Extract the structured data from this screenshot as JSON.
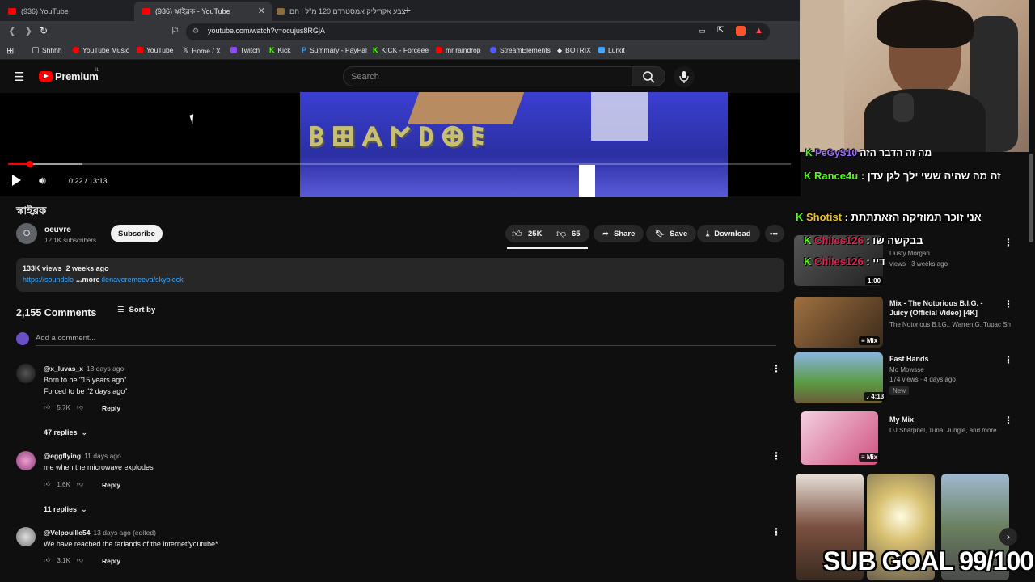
{
  "browser": {
    "tabs": [
      {
        "label": "(936) YouTube"
      },
      {
        "label": "(936) স্কাইব্লক - YouTube"
      },
      {
        "label": "צבע אקריליק אמסטרדם 120 מ\"ל | חם"
      }
    ],
    "new_tab": "+",
    "url": "youtube.com/watch?v=ocujus8RGjA",
    "bookmarks": [
      {
        "label": "Shhhh",
        "color": "#9aa0a6"
      },
      {
        "label": "YouTube Music",
        "color": "#ff0000"
      },
      {
        "label": "YouTube",
        "color": "#ff0000"
      },
      {
        "label": "Home / X",
        "color": "#ffffff"
      },
      {
        "label": "Twitch",
        "color": "#9146ff"
      },
      {
        "label": "Kick",
        "color": "#53fc18"
      },
      {
        "label": "Summary - PayPal",
        "color": "#0070e0"
      },
      {
        "label": "KICK - Forceee",
        "color": "#53fc18"
      },
      {
        "label": "mr raindrop",
        "color": "#ff0000"
      },
      {
        "label": "StreamElements",
        "color": "#4e5bff"
      },
      {
        "label": "BOTRIX",
        "color": "#ffffff"
      },
      {
        "label": "Lurkit",
        "color": "#3ea6ff"
      }
    ]
  },
  "header": {
    "logo_text": "Premium",
    "logo_sup": "IL",
    "search_placeholder": "Search"
  },
  "player": {
    "time": "0:22 / 13:13",
    "progress_fraction": 0.028,
    "buffered_fraction": 0.095
  },
  "video": {
    "title": "স্কাইব্লক",
    "channel_initial": "O",
    "channel_name": "oeuvre",
    "subscribers": "12.1K subscribers",
    "subscribe_label": "Subscribe",
    "likes": "25K",
    "dislikes": "65",
    "share_label": "Share",
    "save_label": "Save",
    "download_label": "Download",
    "views": "133K views",
    "age": "2 weeks ago",
    "desc_link": "https://soundcloud.com/alenaveremeeva/skyblock",
    "more_label": "...more"
  },
  "comments": {
    "count": "2,155 Comments",
    "sort_label": "Sort by",
    "add_placeholder": "Add a comment...",
    "items": [
      {
        "user": "@x_luvas_x",
        "time": "13 days ago",
        "lines": [
          "Born to be \"15 years ago\"",
          "Forced to be \"2 days ago\""
        ],
        "likes": "5.7K",
        "reply_label": "Reply",
        "replies": "47 replies"
      },
      {
        "user": "@eggflying",
        "time": "11 days ago",
        "lines": [
          "me when the microwave explodes"
        ],
        "likes": "1.6K",
        "reply_label": "Reply",
        "replies": "11 replies"
      },
      {
        "user": "@Velpouille54",
        "time": "13 days ago (edited)",
        "lines": [
          "We have reached the farlands of the internet/youtube*"
        ],
        "likes": "3.1K",
        "reply_label": "Reply"
      }
    ]
  },
  "stream_overlay": {
    "chat": [
      {
        "user": "PeGyS10",
        "msg": "מה זה הדבר הזה"
      },
      {
        "user": "Rance4u",
        "msg": "זה מה שהיה ששי ילך לגן עדן"
      },
      {
        "user": "Shotist",
        "msg": "אני זוכר תמוזיקה הזאתתתת"
      },
      {
        "user": "Chiies126",
        "msg": "בבקשה שו"
      },
      {
        "user": "Chiies126",
        "msg": "דיי"
      }
    ],
    "sub_goal": "SUB GOAL 99/100"
  },
  "related": [
    {
      "title": "",
      "meta1": "Dusty Morgan",
      "meta2": "views · 3 weeks ago",
      "badge": "1:00"
    },
    {
      "title": "Mix - The Notorious B.I.G. - Juicy (Official Video) [4K]",
      "meta1": "The Notorious B.I.G., Warren G, Tupac Sh...",
      "meta2": "",
      "badge": "Mix"
    },
    {
      "title": "Fast Hands",
      "meta1": "Mo Mowsse",
      "meta2": "174 views · 4 days ago",
      "badge": "4:13",
      "extra": "New"
    },
    {
      "title": "My Mix",
      "meta1": "DJ Sharpnel, Tuna, Jungle, and more",
      "meta2": "",
      "badge": "Mix"
    }
  ]
}
